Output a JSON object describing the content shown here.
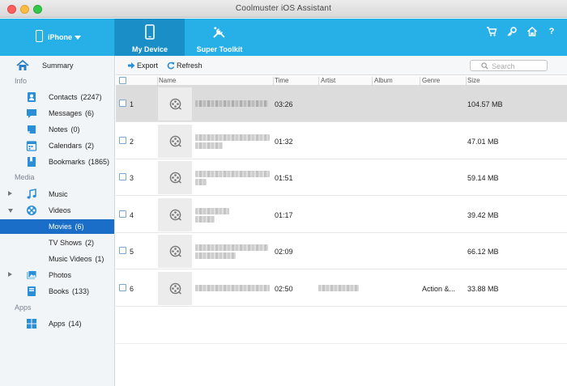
{
  "window": {
    "title": "Coolmuster iOS Assistant"
  },
  "header": {
    "device_label": "iPhone",
    "tabs": [
      {
        "label": "My Device",
        "icon": "phone-icon",
        "active": true
      },
      {
        "label": "Super Toolkit",
        "icon": "tools-icon",
        "active": false
      }
    ],
    "icons": [
      "cart-icon",
      "key-icon",
      "home-icon",
      "help-icon"
    ],
    "help_glyph": "?",
    "accent_color": "#27b0e8",
    "active_tab_color": "#1a8ec6"
  },
  "sidebar": {
    "summary_label": "Summary",
    "sections": [
      {
        "title": "Info",
        "items": [
          {
            "label": "Contacts",
            "count": "(2247)",
            "icon": "contacts-icon"
          },
          {
            "label": "Messages",
            "count": "(6)",
            "icon": "messages-icon"
          },
          {
            "label": "Notes",
            "count": "(0)",
            "icon": "notes-icon"
          },
          {
            "label": "Calendars",
            "count": "(2)",
            "icon": "calendar-icon"
          },
          {
            "label": "Bookmarks",
            "count": "(1865)",
            "icon": "bookmarks-icon"
          }
        ]
      },
      {
        "title": "Media",
        "items": [
          {
            "label": "Music",
            "count": "",
            "icon": "music-icon"
          },
          {
            "label": "Videos",
            "count": "",
            "icon": "videos-icon"
          },
          {
            "label": "Movies",
            "count": "(6)",
            "selected": true
          },
          {
            "label": "TV Shows",
            "count": "(2)"
          },
          {
            "label": "Music Videos",
            "count": "(1)"
          },
          {
            "label": "Photos",
            "count": "",
            "icon": "photos-icon"
          },
          {
            "label": "Books",
            "count": "(133)",
            "icon": "books-icon"
          }
        ]
      },
      {
        "title": "Apps",
        "items": [
          {
            "label": "Apps",
            "count": "(14)",
            "icon": "apps-icon"
          }
        ]
      }
    ],
    "selected_color": "#1a6ec8"
  },
  "toolbar": {
    "export_label": "Export",
    "refresh_label": "Refresh",
    "search_placeholder": "Search"
  },
  "table": {
    "columns": [
      "Name",
      "Time",
      "Artist",
      "Album",
      "Genre",
      "Size"
    ],
    "rows": [
      {
        "index": "1",
        "time": "03:26",
        "genre": "",
        "size": "104.57 MB",
        "selected": true
      },
      {
        "index": "2",
        "time": "01:32",
        "genre": "",
        "size": "47.01 MB"
      },
      {
        "index": "3",
        "time": "01:51",
        "genre": "",
        "size": "59.14 MB"
      },
      {
        "index": "4",
        "time": "01:17",
        "genre": "",
        "size": "39.42 MB"
      },
      {
        "index": "5",
        "time": "02:09",
        "genre": "",
        "size": "66.12 MB"
      },
      {
        "index": "6",
        "time": "02:50",
        "genre": "Action &...",
        "size": "33.88 MB"
      }
    ]
  }
}
